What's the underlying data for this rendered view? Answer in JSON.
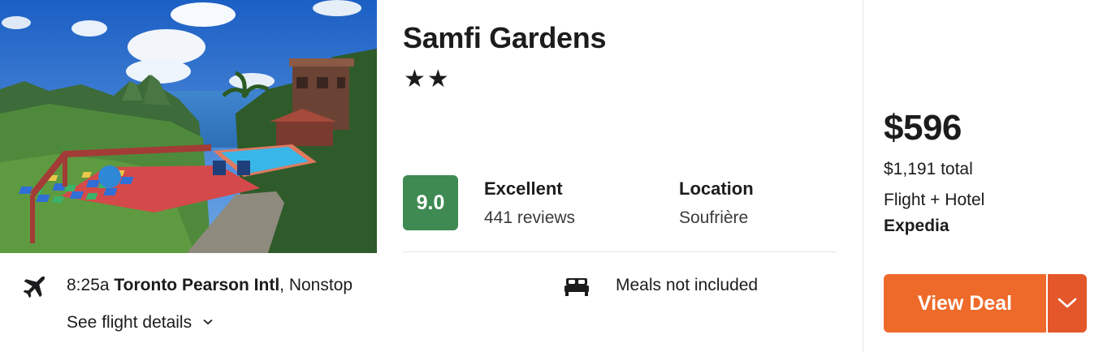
{
  "hotel": {
    "name": "Samfi Gardens",
    "stars": "★★",
    "star_count": 2,
    "image_icon": "resort-pool-photo"
  },
  "rating": {
    "score": "9.0",
    "label": "Excellent",
    "reviews": "441 reviews",
    "badge_color": "#3e8a52"
  },
  "location": {
    "label": "Location",
    "value": "Soufrière"
  },
  "flight": {
    "icon": "plane-icon",
    "time": "8:25a",
    "airport": "Toronto Pearson Intl",
    "stops": ", Nonstop",
    "details_link": "See flight details"
  },
  "meals": {
    "icon": "bed-icon",
    "text": "Meals not included"
  },
  "pricing": {
    "price": "$596",
    "total": "$1,191 total",
    "package": "Flight + Hotel",
    "provider": "Expedia",
    "cta_label": "View Deal",
    "cta_color": "#ee6a2a"
  }
}
